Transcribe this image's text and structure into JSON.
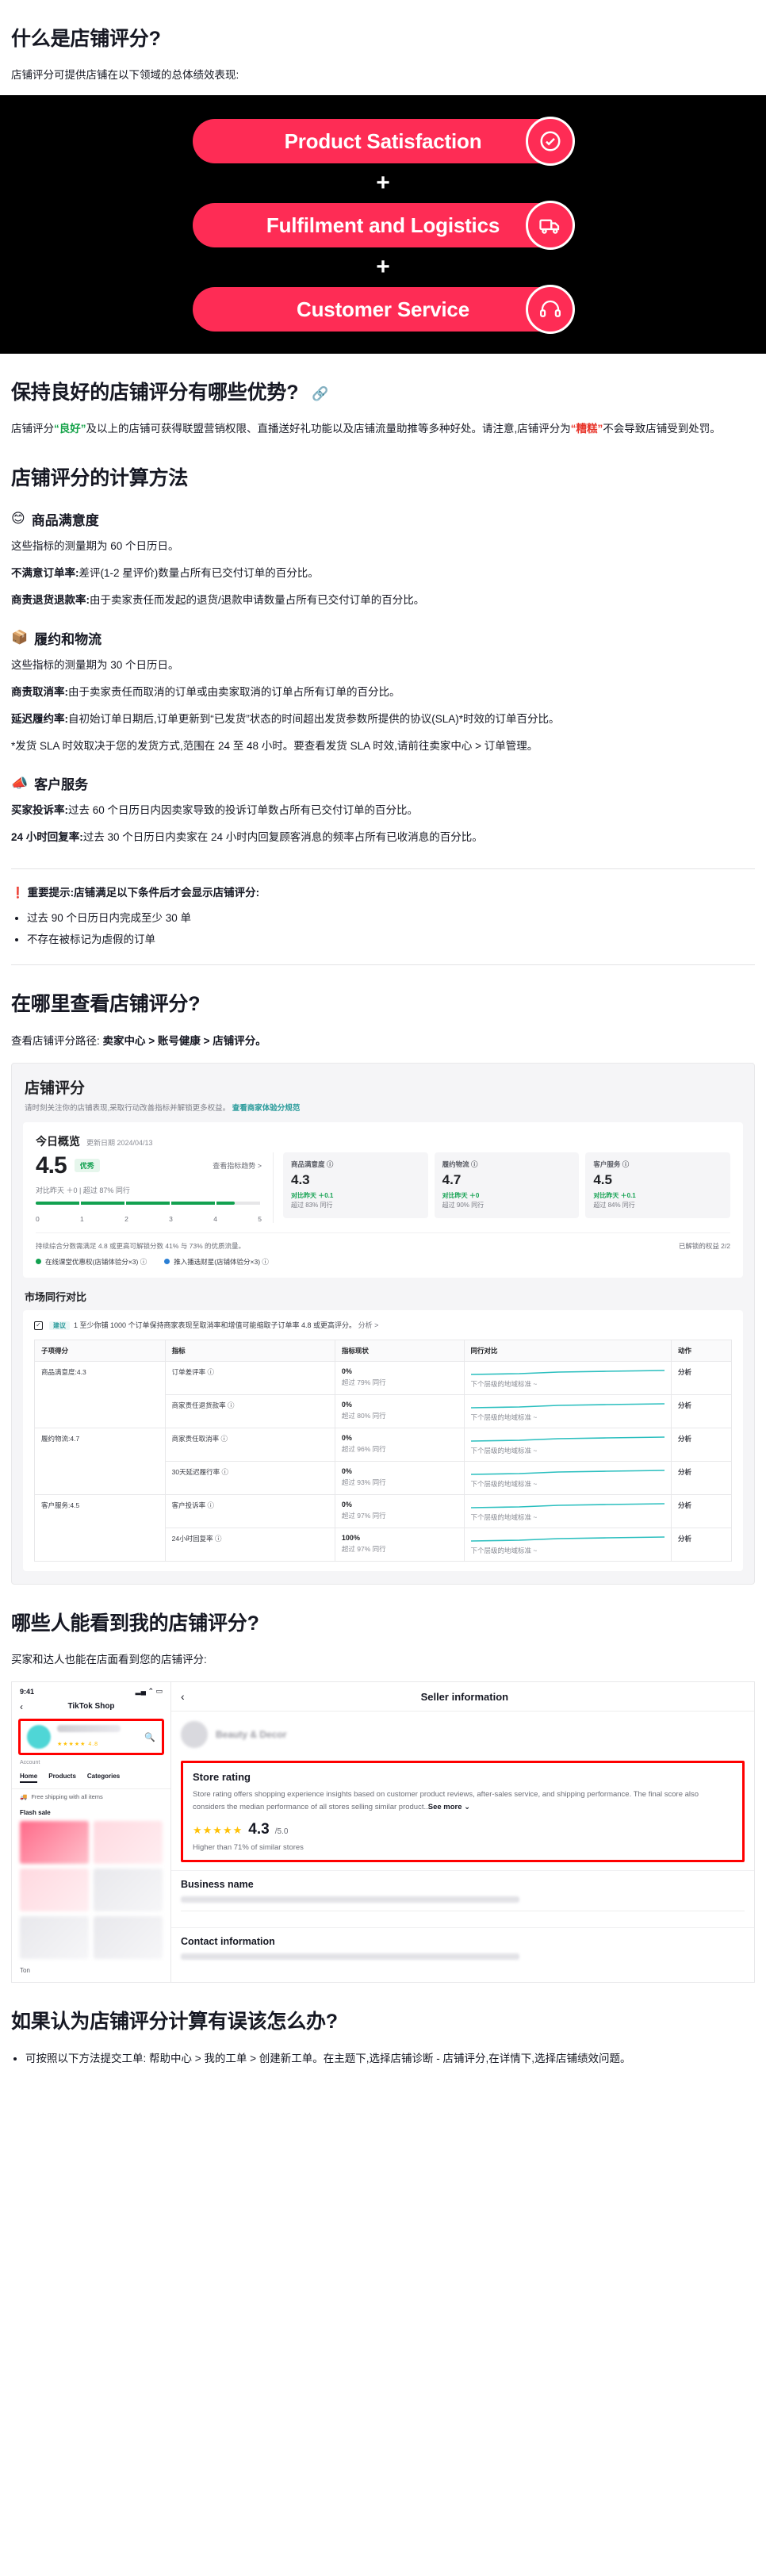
{
  "s1": {
    "heading": "什么是店铺评分?",
    "intro": "店铺评分可提供店铺在以下领域的总体绩效表现:",
    "pills": [
      {
        "label": "Product Satisfaction",
        "icon": "check-circle-icon"
      },
      {
        "label": "Fulfilment and Logistics",
        "icon": "delivery-truck-icon"
      },
      {
        "label": "Customer Service",
        "icon": "headset-agent-icon"
      }
    ],
    "plus": "+"
  },
  "s2": {
    "heading": "保持良好的店铺评分有哪些优势?",
    "link_icon": "link-icon",
    "p1_a": "店铺评分",
    "p1_good": "“良好”",
    "p1_b": "及以上的店铺可获得联盟营销权限、直播送好礼功能以及店铺流量助推等多种好处。请注意,店铺评分为",
    "p1_bad": "“糟糕”",
    "p1_c": "不会导致店铺受到处罚。"
  },
  "s3": {
    "heading": "店铺评分的计算方法",
    "groups": [
      {
        "icon": "smiling-face-emoji",
        "title": "商品满意度",
        "lines": [
          {
            "lead": "",
            "text": "这些指标的测量期为 60 个日历日。"
          },
          {
            "lead": "不满意订单率:",
            "text": "差评(1-2 星评价)数量占所有已交付订单的百分比。"
          },
          {
            "lead": "商责退货退款率:",
            "text": "由于卖家责任而发起的退货/退款申请数量占所有已交付订单的百分比。"
          }
        ]
      },
      {
        "icon": "package-box-emoji",
        "title": "履约和物流",
        "lines": [
          {
            "lead": "",
            "text": "这些指标的测量期为 30 个日历日。"
          },
          {
            "lead": "商责取消率:",
            "text": "由于卖家责任而取消的订单或由卖家取消的订单占所有订单的百分比。"
          },
          {
            "lead": "延迟履约率:",
            "text": "自初始订单日期后,订单更新到“已发货”状态的时间超出发货参数所提供的协议(SLA)*时效的订单百分比。"
          },
          {
            "lead": "",
            "text": "*发货 SLA 时效取决于您的发货方式,范围在 24 至 48 小时。要查看发货 SLA 时效,请前往卖家中心 > 订单管理。"
          }
        ]
      },
      {
        "icon": "loudspeaker-emoji",
        "title": "客户服务",
        "lines": [
          {
            "lead": "买家投诉率:",
            "text": "过去 60 个日历日内因卖家导致的投诉订单数占所有已交付订单的百分比。"
          },
          {
            "lead": "24 小时回复率:",
            "text": "过去 30 个日历日内卖家在 24 小时内回复顾客消息的频率占所有已收消息的百分比。"
          }
        ]
      }
    ]
  },
  "note": {
    "icon": "warning-icon",
    "title": "重要提示:店铺满足以下条件后才会显示店铺评分:",
    "items": [
      "过去 90 个日历日内完成至少 30 单",
      "不存在被标记为虐假的订单"
    ]
  },
  "s4": {
    "heading": "在哪里查看店铺评分?",
    "path_label": "查看店铺评分路径:",
    "path": "卖家中心 > 账号健康 > 店铺评分。",
    "shot": {
      "title": "店铺评分",
      "subtitle": "请时刻关注你的店铺表现,采取行动改善指标并解锁更多权益。",
      "subtitle_link": "查看商家体验分规范",
      "overview_title": "今日概览",
      "overview_date": "更新日期 2024/04/13",
      "score": "4.5",
      "score_chip": "优秀",
      "trend_link": "查看指标趋势 >",
      "compare": "对比昨天 ＋0 | 超过 87% 同行",
      "axis": [
        "0",
        "1",
        "2",
        "3",
        "4",
        "5"
      ],
      "metrics": [
        {
          "label": "商品满意度 ⓘ",
          "value": "4.3",
          "delta": "对比昨天 ＋0.1",
          "peers": "超过 83% 同行"
        },
        {
          "label": "履约物流 ⓘ",
          "value": "4.7",
          "delta": "对比昨天 ＋0",
          "peers": "超过 90% 同行"
        },
        {
          "label": "客户服务 ⓘ",
          "value": "4.5",
          "delta": "对比昨天 ＋0.1",
          "peers": "超过 84% 同行"
        }
      ],
      "footer_note": "持续综合分数需满足 4.8 或更高可解锁分数 41% 与 73% 的优质流量。",
      "footer_right": "已解锁的权益 2/2",
      "tags": [
        {
          "label": "在线课堂优惠权(店铺体验分×3) ⓘ",
          "color": "green"
        },
        {
          "label": "推入播选财星(店铺体验分×3) ⓘ",
          "color": "blue"
        }
      ],
      "compare_title": "市场同行对比",
      "bnote_pill": "建议",
      "bnote_text": "1 至少你铺 1000 个订单保持商家表现至取消率和增值可能缩取子订单率 4.8 或更高评分。",
      "bnote_more": "分析 >",
      "table_headers": [
        "子项得分",
        "指标",
        "指标现状",
        "同行对比",
        "动作"
      ],
      "rows": [
        {
          "group": "商品满意度:4.3",
          "metric": "订单差评率 ⓘ",
          "value": "0%",
          "sub": "超过 79% 同行",
          "peer": "下个层级的地域标准 ~",
          "action": "分析"
        },
        {
          "group": "",
          "metric": "商家责任退货款率 ⓘ",
          "value": "0%",
          "sub": "超过 80% 同行",
          "peer": "下个层级的地域标准 ~",
          "action": "分析"
        },
        {
          "group": "履约物流:4.7",
          "metric": "商家责任取消率 ⓘ",
          "value": "0%",
          "sub": "超过 96% 同行",
          "peer": "下个层级的地域标准 ~",
          "action": "分析"
        },
        {
          "group": "",
          "metric": "30天延迟履行率 ⓘ",
          "value": "0%",
          "sub": "超过 93% 同行",
          "peer": "下个层级的地域标准 ~",
          "action": "分析"
        },
        {
          "group": "客户服务:4.5",
          "metric": "客户投诉率 ⓘ",
          "value": "0%",
          "sub": "超过 97% 同行",
          "peer": "下个层级的地域标准 ~",
          "action": "分析"
        },
        {
          "group": "",
          "metric": "24小时回复率 ⓘ",
          "value": "100%",
          "sub": "超过 97% 同行",
          "peer": "下个层级的地域标准 ~",
          "action": "分析"
        }
      ]
    }
  },
  "s5": {
    "heading": "哪些人能看到我的店铺评分?",
    "intro": "买家和达人也能在店面看到您的店铺评分:",
    "phone_left": {
      "time": "9:41",
      "signal_icon": "cellular-wifi-battery-icon",
      "shop_title": "TikTok Shop",
      "back_icon": "chevron-left-icon",
      "search_icon": "search-icon",
      "stars": "★★★★★",
      "rating": "4.8",
      "account_label": "Account",
      "tabs": [
        "Home",
        "Products",
        "Categories"
      ],
      "ship_icon": "truck-icon",
      "ship_text": "Free shipping with all items",
      "flash": "Flash sale",
      "footer": "Ton"
    },
    "phone_right": {
      "back_icon": "chevron-left-icon",
      "title": "Seller information",
      "store_name": "Beauty & Decor",
      "rating_title": "Store rating",
      "rating_desc": "Store rating offers shopping experience insights based on customer product reviews, after-sales service, and shipping performance. The final score also considers the median performance of all stores selling similar product..",
      "see_more": "See more ⌄",
      "stars": "★★★★★",
      "score": "4.3",
      "score_den": "/5.0",
      "higher": "Higher than 71% of similar stores",
      "business_title": "Business name",
      "contact_title": "Contact information"
    }
  },
  "s6": {
    "heading": "如果认为店铺评分计算有误该怎么办?",
    "items": [
      "可按照以下方法提交工单: 帮助中心 > 我的工单 > 创建新工单。在主题下,选择店铺诊断 - 店铺评分,在详情下,选择店铺绩效问题。"
    ]
  }
}
